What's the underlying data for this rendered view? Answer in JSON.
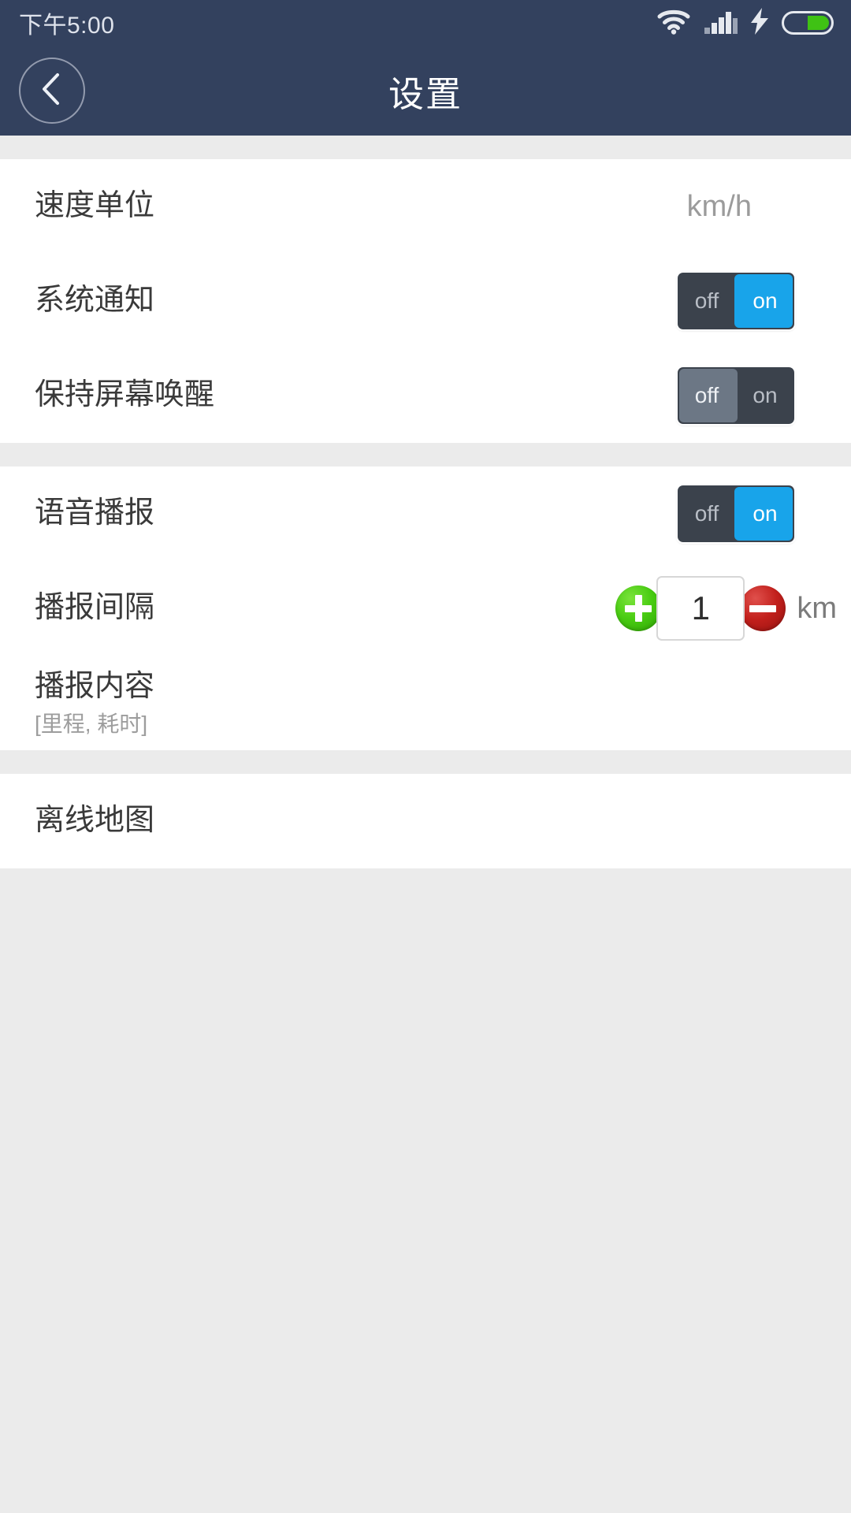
{
  "status_bar": {
    "clock": "下午5:00",
    "icons": [
      "wifi-icon",
      "cellular-signal-icon",
      "charging-bolt-icon",
      "battery-icon"
    ],
    "battery_fill_color": "#3fc214"
  },
  "header": {
    "title": "设置",
    "back_icon": "chevron-left-icon",
    "background_color": "#33415e",
    "title_color": "#ffffff"
  },
  "theme": {
    "page_background": "#ebebeb",
    "card_background": "#ffffff",
    "toggle_track": "#3b424c",
    "toggle_on_accent": "#18a4ea",
    "toggle_off_accent": "#6c7785",
    "plus_button_color": "#49cc12",
    "minus_button_color": "#c2201c",
    "primary_text": "#3a3a3a",
    "secondary_text": "#9b9b9b"
  },
  "sections": [
    {
      "rows": [
        {
          "title": "速度单位",
          "control": "value",
          "value": "km/h"
        },
        {
          "title": "系统通知",
          "control": "toggle",
          "state": "on",
          "off_label": "off",
          "on_label": "on"
        },
        {
          "title": "保持屏幕唤醒",
          "control": "toggle",
          "state": "off",
          "off_label": "off",
          "on_label": "on"
        }
      ]
    },
    {
      "rows": [
        {
          "title": "语音播报",
          "control": "toggle",
          "state": "on",
          "off_label": "off",
          "on_label": "on"
        },
        {
          "title": "播报间隔",
          "control": "stepper",
          "value": "1",
          "unit": "km",
          "increment_icon": "plus-circle-icon",
          "decrement_icon": "minus-circle-icon"
        },
        {
          "title": "播报内容",
          "subtitle": "[里程, 耗时]",
          "control": "none"
        }
      ]
    },
    {
      "rows": [
        {
          "title": "离线地图",
          "control": "none"
        }
      ]
    }
  ]
}
